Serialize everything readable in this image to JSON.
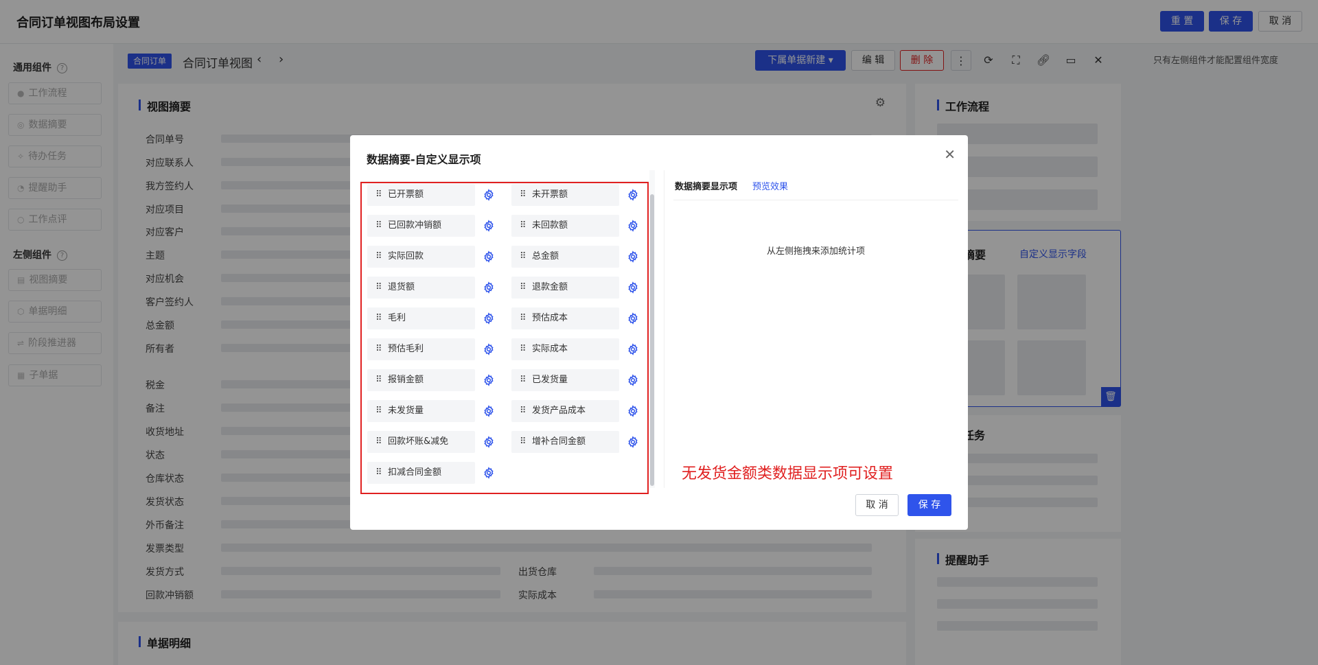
{
  "header": {
    "title": "合同订单视图布局设置",
    "reset_label": "重 置",
    "save_label": "保 存",
    "cancel_label": "取 消"
  },
  "left_panel": {
    "general_title": "通用组件",
    "general_items": [
      "工作流程",
      "数据摘要",
      "待办任务",
      "提醒助手",
      "工作点评"
    ],
    "side_title": "左侧组件",
    "side_items": [
      "视图摘要",
      "单据明细",
      "阶段推进器",
      "子单据"
    ],
    "help": "?"
  },
  "view_header": {
    "tag": "合同订单",
    "title": "合同订单视图",
    "new_sub_label": "下属单据新建",
    "edit_label": "编 辑",
    "delete_label": "删 除"
  },
  "right_note": "只有左侧组件才能配置组件宽度",
  "view_summary": {
    "title": "视图摘要",
    "fields": [
      "合同单号",
      "对应联系人",
      "我方签约人",
      "对应项目",
      "对应客户",
      "主题",
      "对应机会",
      "客户签约人",
      "总金额",
      "所有者",
      "税金",
      "备注",
      "收货地址",
      "状态",
      "仓库状态",
      "发货状态",
      "外币备注",
      "发票类型",
      "发货方式",
      "回款冲销额"
    ],
    "right_fields": [
      "出货仓库",
      "实际成本"
    ]
  },
  "detail_section": {
    "title": "单据明细"
  },
  "right_column": {
    "workflow_title": "工作流程",
    "summary_title": "摘要",
    "custom_link": "自定义显示字段",
    "task_title": "任务",
    "reminder_title": "提醒助手"
  },
  "modal": {
    "title": "数据摘要-自定义显示项",
    "chips": [
      [
        "已开票额",
        "未开票额"
      ],
      [
        "已回款冲销额",
        "未回款额"
      ],
      [
        "实际回款",
        "总金额"
      ],
      [
        "退货额",
        "退款金额"
      ],
      [
        "毛利",
        "预估成本"
      ],
      [
        "预估毛利",
        "实际成本"
      ],
      [
        "报销金额",
        "已发货量"
      ],
      [
        "未发货量",
        "发货产品成本"
      ],
      [
        "回款坏账&减免",
        "增补合同金额"
      ],
      [
        "扣减合同金额",
        ""
      ]
    ],
    "tab_display": "数据摘要显示项",
    "tab_preview": "预览效果",
    "empty_hint": "从左侧拖拽来添加统计项",
    "annotation": "无发货金额类数据显示项可设置",
    "cancel_label": "取 消",
    "save_label": "保 存"
  },
  "colors": {
    "primary": "#2f54eb",
    "danger": "#e02020",
    "annotation": "#e02020"
  }
}
